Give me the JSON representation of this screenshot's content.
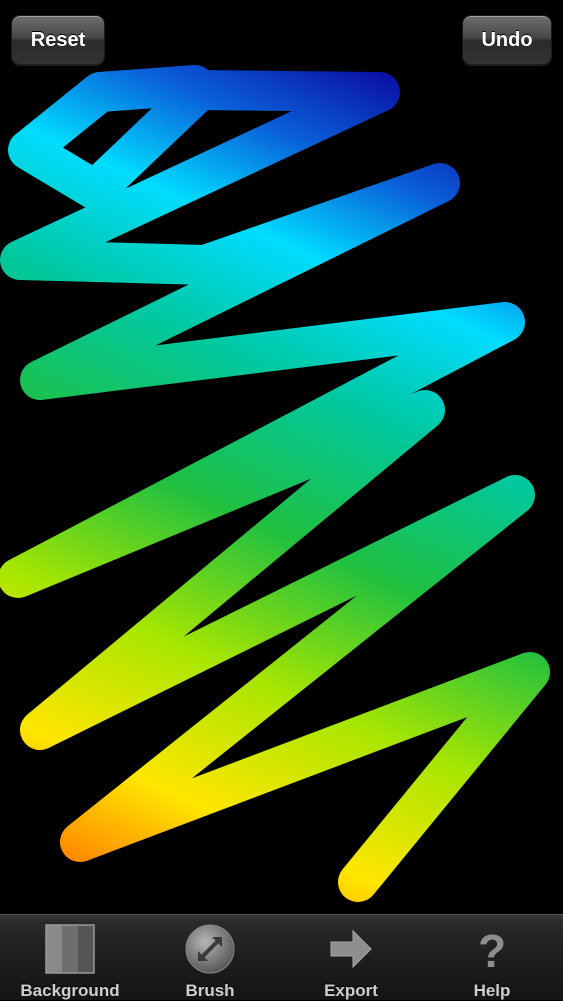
{
  "header": {
    "reset_label": "Reset",
    "undo_label": "Undo"
  },
  "canvas": {
    "background_color": "#000000",
    "stroke_gradient": [
      "#ff8a00",
      "#ffff00",
      "#7ee000",
      "#00c070",
      "#00e5ff",
      "#0030d0",
      "#000099"
    ]
  },
  "toolbar": {
    "items": [
      {
        "label": "Background",
        "icon": "background-swatch-icon"
      },
      {
        "label": "Brush",
        "icon": "brush-resize-icon"
      },
      {
        "label": "Export",
        "icon": "arrow-right-icon"
      },
      {
        "label": "Help",
        "icon": "question-mark-icon"
      }
    ]
  }
}
